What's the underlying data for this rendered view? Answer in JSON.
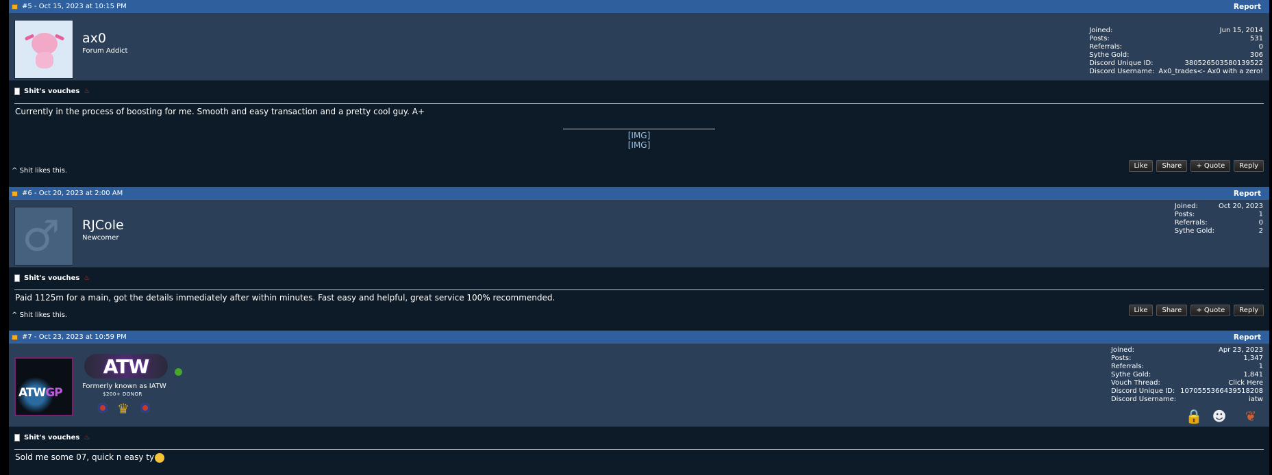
{
  "posts": [
    {
      "header": "#5 - Oct 15, 2023 at 10:15 PM",
      "report": "Report",
      "username": "ax0",
      "title": "Forum Addict",
      "stats": [
        {
          "label": "Joined:",
          "value": "Jun 15, 2014"
        },
        {
          "label": "Posts:",
          "value": "531"
        },
        {
          "label": "Referrals:",
          "value": "0"
        },
        {
          "label": "Sythe Gold:",
          "value": "306"
        },
        {
          "label": "Discord Unique ID:",
          "value": "380526503580139522"
        },
        {
          "label": "Discord Username:",
          "value": "Ax0_trades<- Ax0 with a zero!"
        }
      ],
      "thread": "Shit's vouches",
      "message": "Currently in the process of boosting for me. Smooth and easy transaction and a pretty cool guy. A+",
      "img1": "[IMG]",
      "img2": "[IMG]",
      "likes": "Shit likes this."
    },
    {
      "header": "#6 - Oct 20, 2023 at 2:00 AM",
      "report": "Report",
      "username": "RJCole",
      "title": "Newcomer",
      "stats": [
        {
          "label": "Joined:",
          "value": "Oct 20, 2023"
        },
        {
          "label": "Posts:",
          "value": "1"
        },
        {
          "label": "Referrals:",
          "value": "0"
        },
        {
          "label": "Sythe Gold:",
          "value": "2"
        }
      ],
      "thread": "Shit's vouches",
      "message": "Paid 1125m for a main, got the details immediately after within minutes. Fast easy and helpful, great service 100% recommended.",
      "likes": "Shit likes this."
    },
    {
      "header": "#7 - Oct 23, 2023 at 10:59 PM",
      "report": "Report",
      "banner": "ATW",
      "title": "Formerly known as IATW",
      "donor": "$200+ DONOR",
      "avatar_text_a": "ATW",
      "avatar_text_b": "GP",
      "stats": [
        {
          "label": "Joined:",
          "value": "Apr 23, 2023"
        },
        {
          "label": "Posts:",
          "value": "1,347"
        },
        {
          "label": "Referrals:",
          "value": "1"
        },
        {
          "label": "Sythe Gold:",
          "value": "1,841"
        },
        {
          "label": "Vouch Thread:",
          "value": "Click Here"
        },
        {
          "label": "Discord Unique ID:",
          "value": "1070555366439518208"
        },
        {
          "label": "Discord Username:",
          "value": "iatw"
        }
      ],
      "thread": "Shit's vouches",
      "message": "Sold me some 07, quick n easy ty"
    }
  ],
  "buttons": {
    "like": "Like",
    "share": "Share",
    "quote": "+ Quote",
    "reply": "Reply"
  },
  "likes_marker": "^",
  "icons": [
    "post-icon",
    "doc-icon",
    "flame-icon",
    "male-symbol-icon",
    "online-dot-icon",
    "medal-icon",
    "trophy-icon",
    "lock-icon",
    "spy-icon",
    "squirrel-icon",
    "smile-emoji-icon"
  ]
}
